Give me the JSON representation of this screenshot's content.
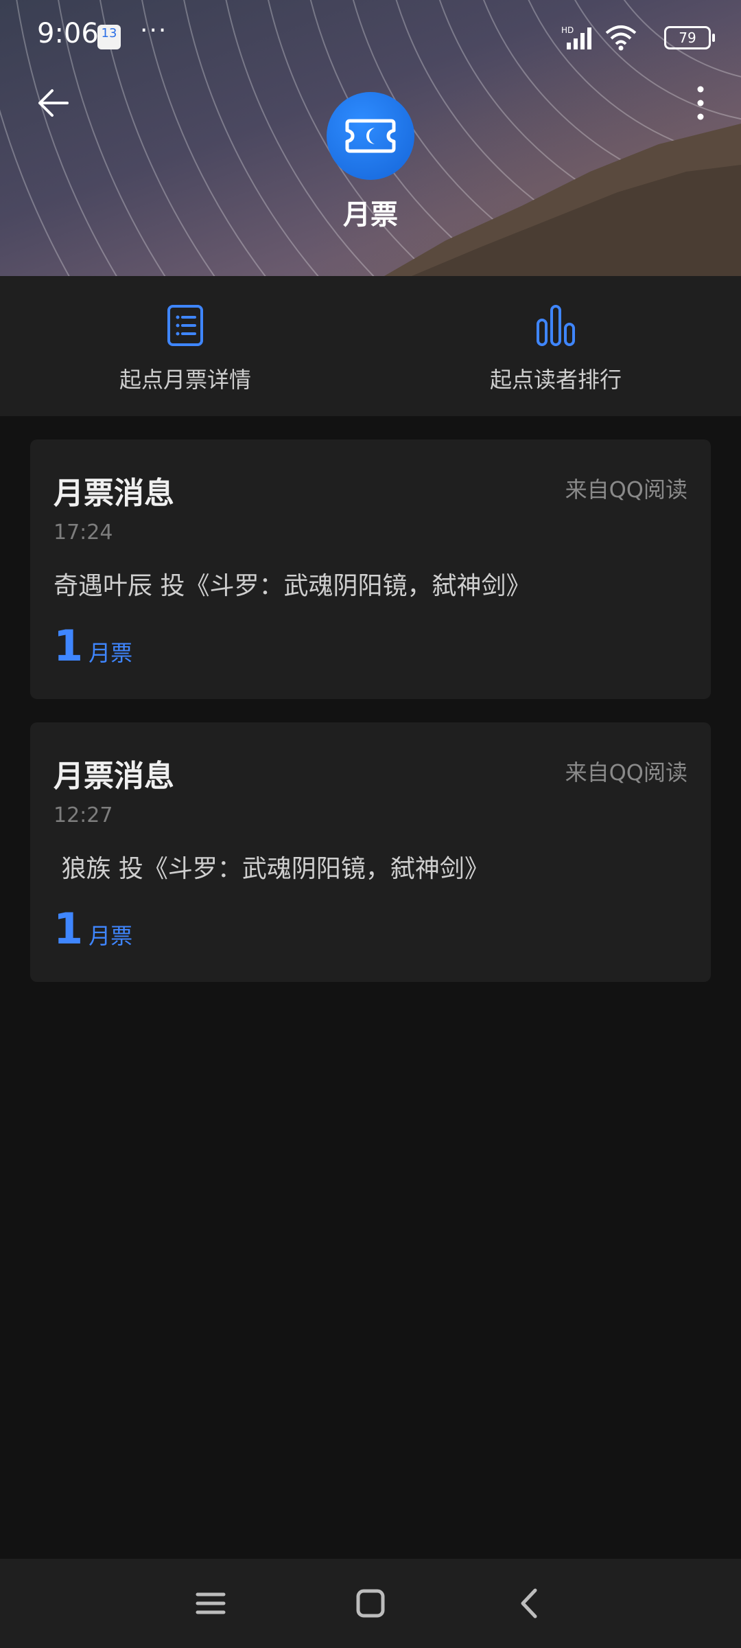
{
  "status_bar": {
    "time": "9:06",
    "calendar_badge": "13",
    "more_indicator": "···",
    "battery": "79",
    "signal_label": "HD"
  },
  "header": {
    "title": "月票",
    "back_icon": "arrow-left-icon",
    "menu_icon": "more-vertical-icon",
    "badge_icon": "ticket-moon-icon"
  },
  "actions": [
    {
      "label": "起点月票详情",
      "icon": "list-document-icon"
    },
    {
      "label": "起点读者排行",
      "icon": "bar-chart-icon"
    }
  ],
  "messages": [
    {
      "title": "月票消息",
      "source": "来自QQ阅读",
      "time": "17:24",
      "text": "奇遇叶辰 投《斗罗：武魂阴阳镜，弑神剑》",
      "count": "1",
      "unit": "月票"
    },
    {
      "title": "月票消息",
      "source": "来自QQ阅读",
      "time": "12:27",
      "text": " 狼族 投《斗罗：武魂阴阳镜，弑神剑》",
      "count": "1",
      "unit": "月票"
    }
  ],
  "nav": {
    "menu_icon": "menu-icon",
    "home_icon": "home-square-icon",
    "back_icon": "back-chevron-icon"
  },
  "colors": {
    "accent": "#3f86ff",
    "background": "#121212",
    "card": "#1f1f1f"
  }
}
